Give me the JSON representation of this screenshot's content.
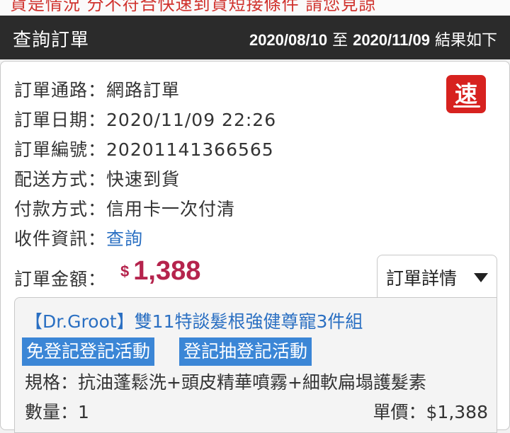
{
  "notice": {
    "text": "貨是情況 分不符合快速到貨短接條件 請您見諒"
  },
  "header": {
    "title": "查詢訂單",
    "date_from": "2020/08/10",
    "to_word": "至",
    "date_to": "2020/11/09",
    "result_text": "結果如下"
  },
  "order": {
    "channel_label": "訂單通路：",
    "channel_value": "網路訂單",
    "date_label": "訂單日期：",
    "date_value": "2020/11/09 22:26",
    "number_label": "訂單編號：",
    "number_value": "20201141366565",
    "shipping_label": "配送方式：",
    "shipping_value": "快速到貨",
    "payment_label": "付款方式：",
    "payment_value": "信用卡一次付清",
    "recipient_label": "收件資訊：",
    "recipient_link": "查詢",
    "amount_label": "訂單金額：",
    "currency": "$",
    "amount": "1,388",
    "speed_badge": "速",
    "details_button": "訂單詳情"
  },
  "product": {
    "title": "【Dr.Groot】雙11特談髮根強健尊寵3件組",
    "tags": [
      "免登記登記活動",
      "登記抽登記活動"
    ],
    "spec_label": "規格：",
    "spec_value": "抗油蓬鬆洗+頭皮精華噴霧+細軟扁塌護髮素",
    "qty_label": "數量：",
    "qty_value": "1",
    "price_label": "單價：",
    "price_value": "$1,388"
  },
  "colors": {
    "header_bg": "#2b2b2b",
    "amount": "#b5244d",
    "link": "#2a6fc2",
    "tag_bg": "#3b86d6",
    "badge": "#d7221f"
  },
  "icons": {
    "details_toggle": "triangle-down-icon"
  }
}
